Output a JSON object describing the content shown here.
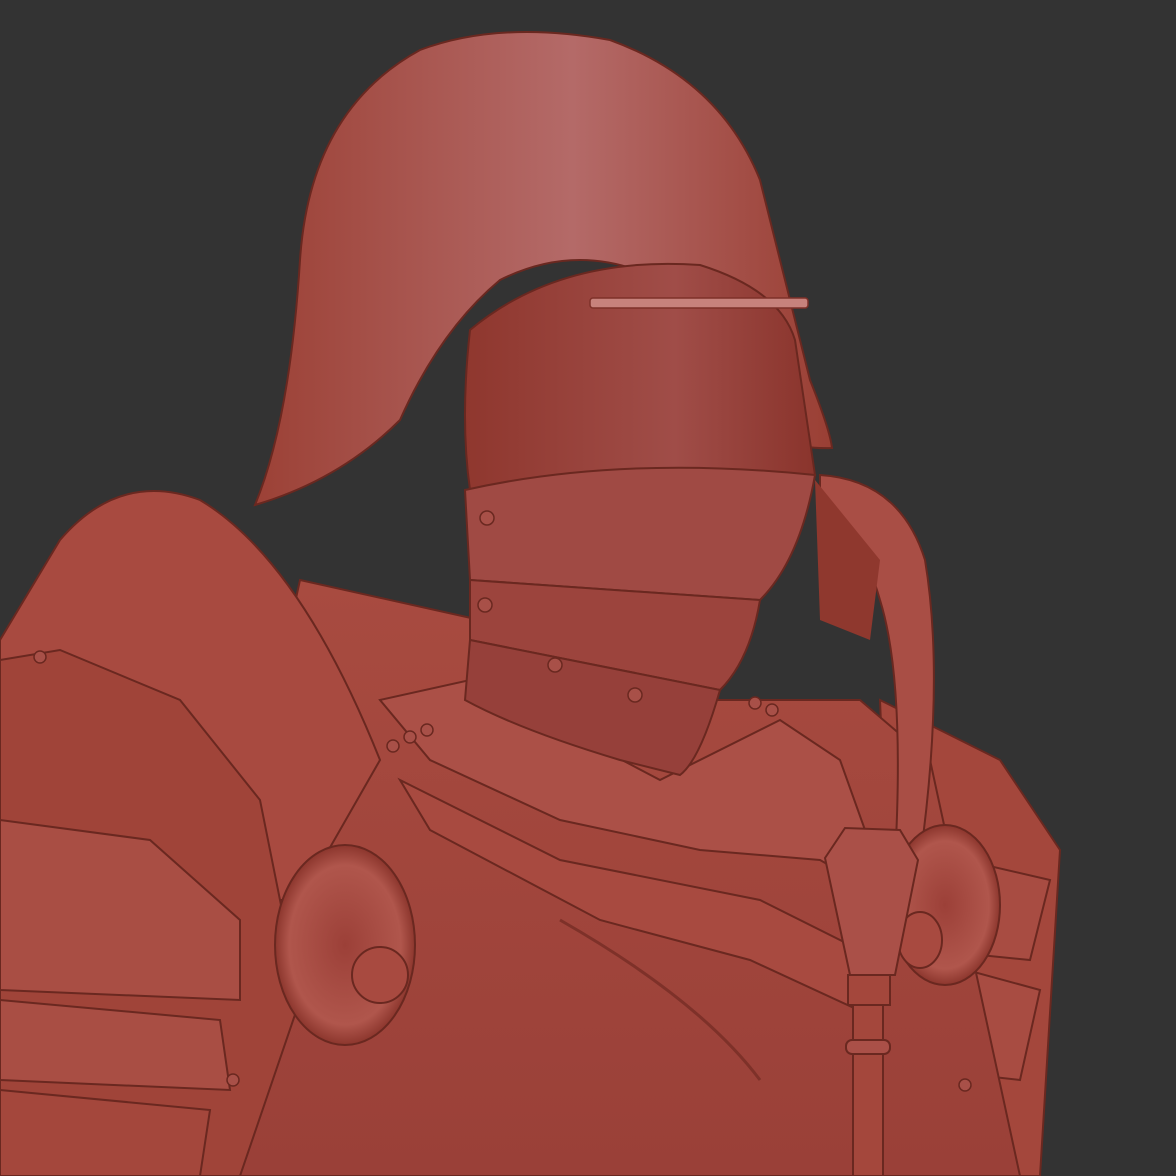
{
  "scene": {
    "subject": "knight-armor-render",
    "colors": {
      "background": "#333333",
      "armor_base": "#a4473c",
      "armor_light": "#b86a66",
      "armor_dark": "#7e3129",
      "outline": "#6a2820"
    }
  }
}
